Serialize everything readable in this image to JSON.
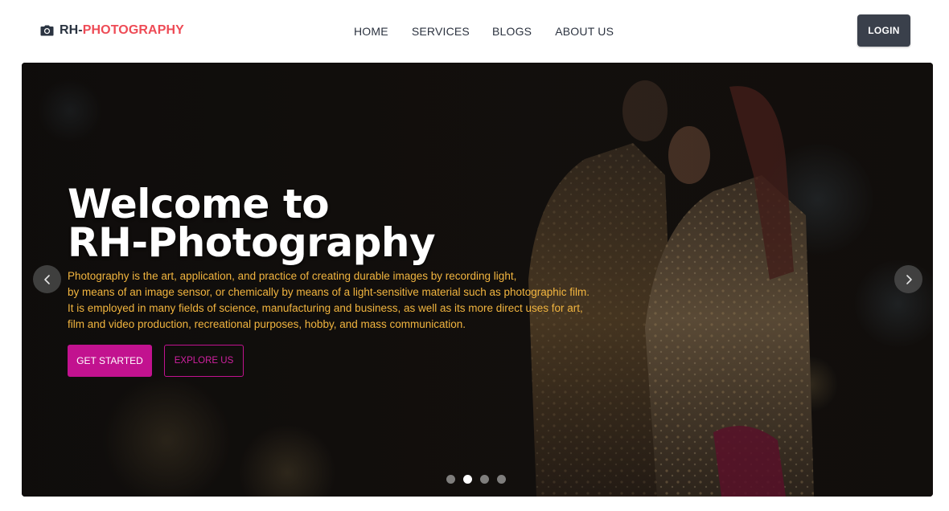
{
  "header": {
    "brand_prefix": "RH-",
    "brand_suffix": "PHOTOGRAPHY",
    "nav": [
      "HOME",
      "SERVICES",
      "BLOGS",
      "ABOUT US"
    ],
    "login_label": "LOGIN"
  },
  "hero": {
    "title_line1": "Welcome to",
    "title_line2": "RH-Photography",
    "description": [
      "Photography is the art, application, and practice of creating durable images by recording light,",
      "by means of an image sensor, or chemically by means of a light-sensitive material such as photographic film.",
      "It is employed in many fields of science, manufacturing and business, as well as its more direct uses for art,",
      "film and video production, recreational purposes, hobby, and mass communication."
    ],
    "primary_button": "GET STARTED",
    "secondary_button": "EXPLORE US",
    "carousel": {
      "slide_count": 4,
      "active_index": 1
    }
  },
  "colors": {
    "brand_accent": "#ee4b56",
    "primary_button": "#c2128f",
    "description_text": "#f2b53f",
    "login_button": "#3a404b"
  },
  "icons": {
    "brand": "camera-icon",
    "prev": "chevron-left-icon",
    "next": "chevron-right-icon"
  }
}
